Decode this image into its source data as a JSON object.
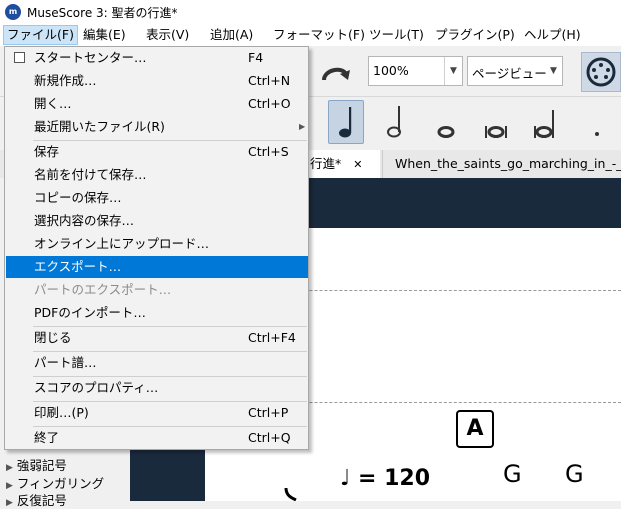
{
  "window": {
    "title": "MuseScore 3: 聖者の行進*",
    "app_icon": "musescore-icon"
  },
  "menubar": [
    {
      "label": "ファイル(F)",
      "active": true
    },
    {
      "label": "編集(E)"
    },
    {
      "label": "表示(V)"
    },
    {
      "label": "追加(A)"
    },
    {
      "label": "フォーマット(F)"
    },
    {
      "label": "ツール(T)"
    },
    {
      "label": "プラグイン(P)"
    },
    {
      "label": "ヘルプ(H)"
    }
  ],
  "toolbar": {
    "zoom": "100%",
    "view_mode": "ページビュー",
    "redo_icon": "redo-icon",
    "midi_icon": "midi-input-icon"
  },
  "tabs": {
    "active": "行進*",
    "close": "✕",
    "other": "When_the_saints_go_marching_in_-_T"
  },
  "file_menu": {
    "items": [
      {
        "label": "スタートセンター…",
        "shortcut": "F4",
        "checkbox": true
      },
      {
        "label": "新規作成…",
        "shortcut": "Ctrl+N"
      },
      {
        "label": "開く…",
        "shortcut": "Ctrl+O"
      },
      {
        "label": "最近開いたファイル(R)",
        "shortcut": "",
        "submenu": true
      },
      {
        "label": "保存",
        "shortcut": "Ctrl+S"
      },
      {
        "label": "名前を付けて保存…",
        "shortcut": ""
      },
      {
        "label": "コピーの保存…",
        "shortcut": ""
      },
      {
        "label": "選択内容の保存…",
        "shortcut": ""
      },
      {
        "label": "オンライン上にアップロード…",
        "shortcut": ""
      },
      {
        "label": "エクスポート…",
        "shortcut": "",
        "highlighted": true
      },
      {
        "label": "パートのエクスポート…",
        "shortcut": "",
        "disabled": true
      },
      {
        "label": "PDFのインポート…",
        "shortcut": ""
      },
      {
        "label": "閉じる",
        "shortcut": "Ctrl+F4"
      },
      {
        "label": "パート譜…",
        "shortcut": ""
      },
      {
        "label": "スコアのプロパティ…",
        "shortcut": ""
      },
      {
        "label": "印刷…(P)",
        "shortcut": "Ctrl+P"
      },
      {
        "label": "終了",
        "shortcut": "Ctrl+Q"
      }
    ]
  },
  "palette": {
    "items": [
      "強弱記号",
      "フィンガリング",
      "反復記号"
    ]
  },
  "score": {
    "rehearsal_mark": "A",
    "tempo": "♩ = 120",
    "chords": [
      "G",
      "G"
    ]
  },
  "colors": {
    "highlight": "#0078d7",
    "dark_bg": "#1a2a3d"
  }
}
